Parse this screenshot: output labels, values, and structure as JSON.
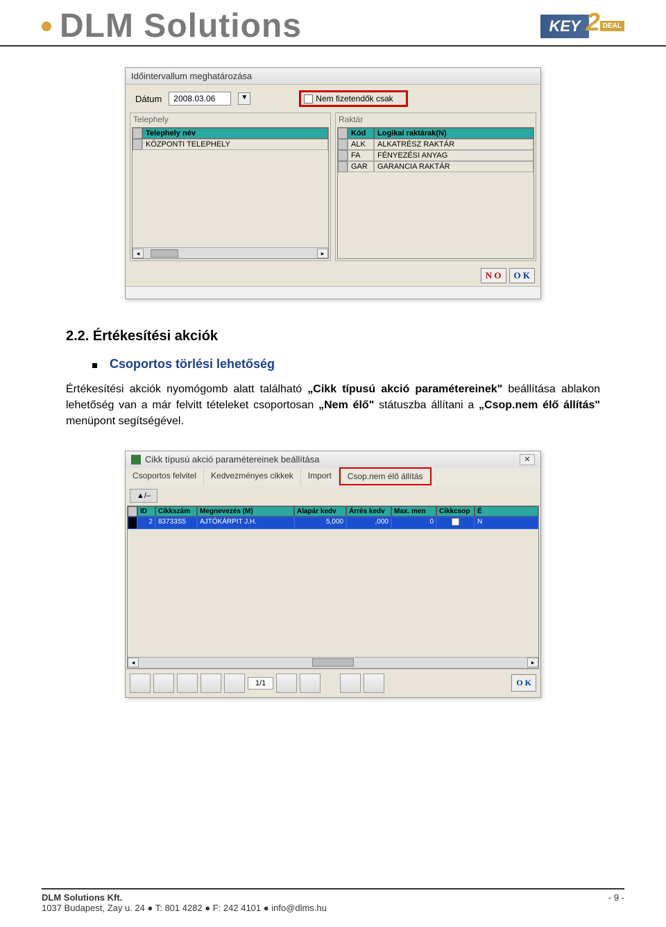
{
  "header": {
    "logo_text": "DLM Solutions",
    "key_label": "KEY",
    "key_num": "2",
    "deal_label": "DEAL"
  },
  "shot1": {
    "title": "Időintervallum meghatározása",
    "date_label": "Dátum",
    "date_value": "2008.03.06",
    "checkbox_label": "Nem fizetendők csak",
    "left_caption": "Telephely",
    "left_header": "Telephely név",
    "left_row": "KÖZPONTI TELEPHELY",
    "right_caption": "Raktár",
    "right_h1": "Kód",
    "right_h2": "Logikai raktárak(N)",
    "right_rows": [
      {
        "k": "ALK",
        "n": "ALKATRÉSZ RAKTÁR"
      },
      {
        "k": "FA",
        "n": "FÉNYEZÉSI ANYAG"
      },
      {
        "k": "GAR",
        "n": "GARANCIA RAKTÁR"
      }
    ],
    "no": "N O",
    "ok": "O K"
  },
  "section": {
    "heading": "2.2. Értékesítési akciók",
    "bullet": "Csoportos törlési lehetőség",
    "para_pre": "Értékesítési akciók nyomógomb alatt található ",
    "para_b1": "„Cikk típusú akció paramétereinek\"",
    "para_mid": " beállítása ablakon lehetőség van a már felvitt tételeket csoportosan ",
    "para_b2": "„Nem élő\"",
    "para_mid2": " státuszba állítani a ",
    "para_b3": "„Csop.nem élő állítás\"",
    "para_end": " menüpont segítségével."
  },
  "shot2": {
    "title": "Cikk típusú akció paramétereinek beállítása",
    "tabs": [
      "Csoportos felvitel",
      "Kedvezményes cikkek",
      "Import",
      "Csop.nem élő állítás"
    ],
    "filter_btn": "▲/–",
    "headers": [
      "",
      "ID",
      "Cikkszám",
      "Megnevezés (M)",
      "Alapár kedv",
      "Árrés kedv",
      "Max. men",
      "Cikkcsop",
      "É"
    ],
    "row": [
      "",
      "2",
      "83733S5",
      "AJTÓKÁRPIT J.H.",
      "5,000",
      ",000",
      "0",
      "",
      "N"
    ],
    "page": "1/1",
    "ok": "O K"
  },
  "footer": {
    "company": "DLM Solutions Kft.",
    "address": "1037 Budapest, Zay u. 24 ● T: 801 4282 ● F: 242 4101 ● info@dlms.hu",
    "page": "- 9 -"
  }
}
